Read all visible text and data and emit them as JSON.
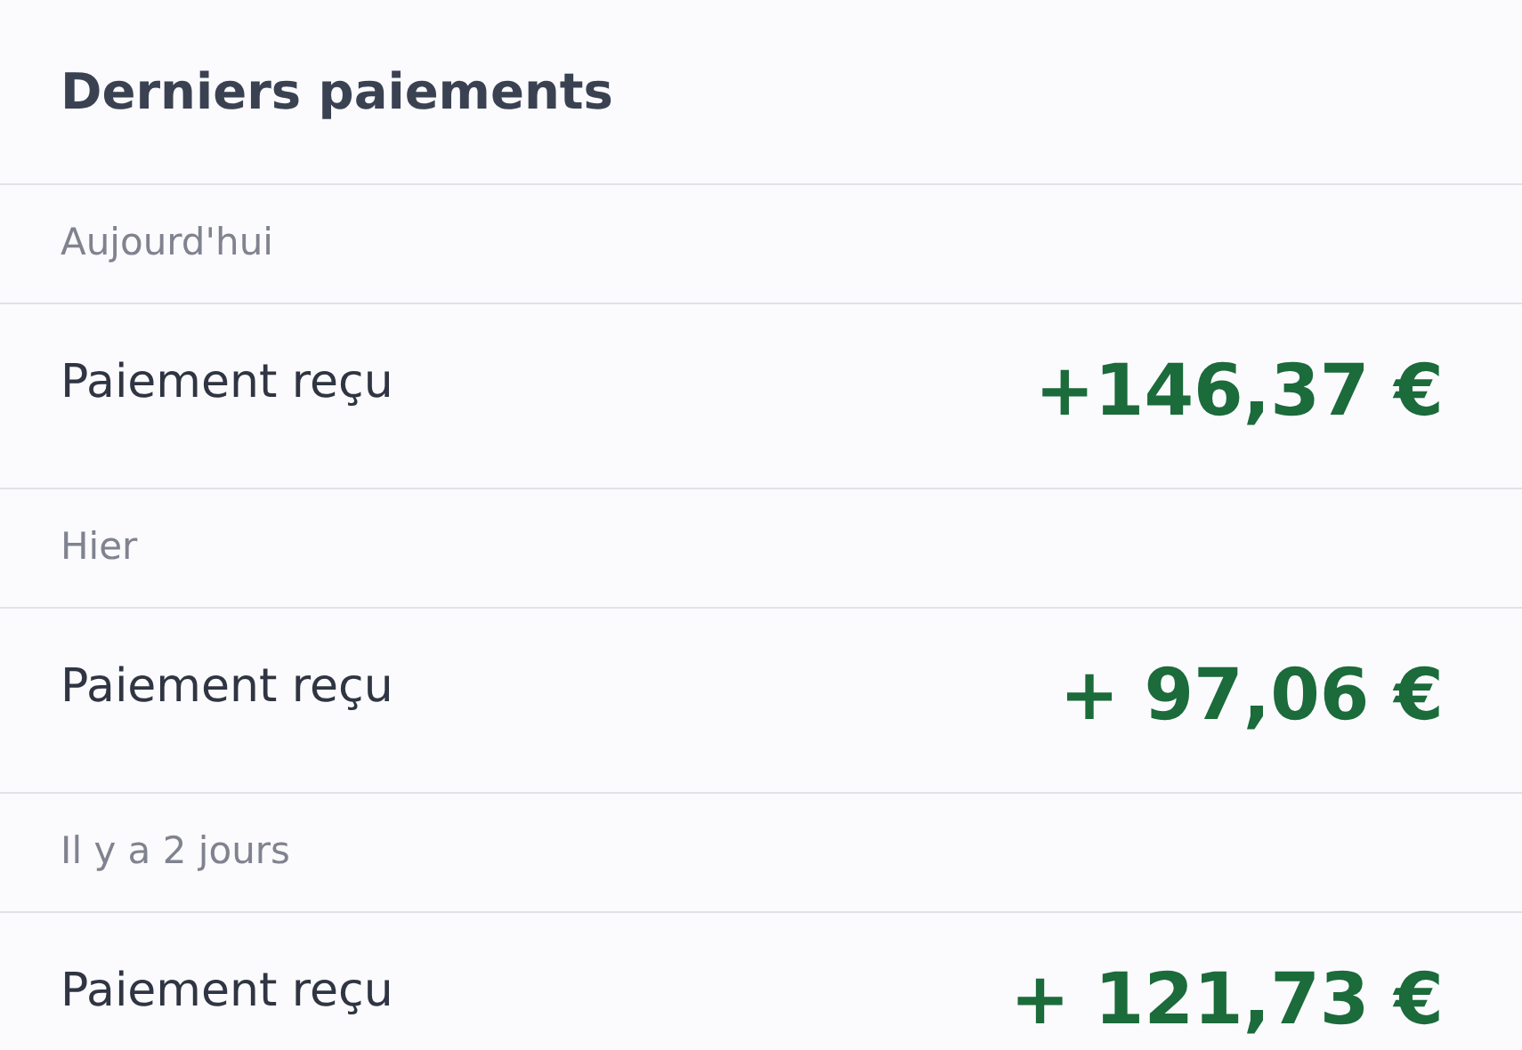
{
  "title": "Derniers paiements",
  "groups": [
    {
      "day": "Aujourd'hui",
      "payments": [
        {
          "label": "Paiement reçu",
          "amount": "+146,37 €"
        }
      ]
    },
    {
      "day": "Hier",
      "payments": [
        {
          "label": "Paiement reçu",
          "amount": "+ 97,06 €"
        }
      ]
    },
    {
      "day": "Il y a 2 jours",
      "payments": [
        {
          "label": "Paiement reçu",
          "amount": "+ 121,73 €"
        }
      ]
    }
  ]
}
